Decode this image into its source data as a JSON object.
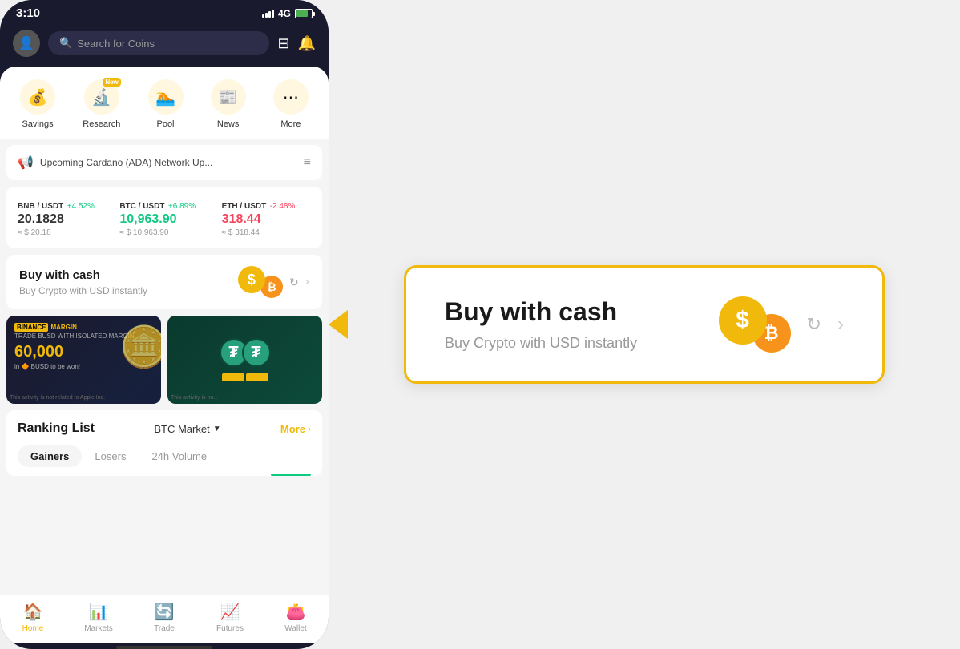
{
  "phone": {
    "statusBar": {
      "time": "3:10",
      "signal": "4G",
      "battery": "80%"
    },
    "searchBar": {
      "placeholder": "Search for Coins"
    },
    "quickActions": [
      {
        "id": "savings",
        "label": "Savings",
        "icon": "💰",
        "badge": null
      },
      {
        "id": "research",
        "label": "Research",
        "icon": "🔬",
        "badge": "New"
      },
      {
        "id": "pool",
        "label": "Pool",
        "icon": "🏊",
        "badge": null
      },
      {
        "id": "news",
        "label": "News",
        "icon": "📰",
        "badge": null
      },
      {
        "id": "more",
        "label": "More",
        "icon": "⋯",
        "badge": null
      }
    ],
    "announcement": {
      "text": "Upcoming Cardano (ADA) Network Up..."
    },
    "priceTicker": [
      {
        "pair": "BNB / USDT",
        "change": "+4.52%",
        "positive": true,
        "price": "20.1828",
        "usd": "≈ $ 20.18"
      },
      {
        "pair": "BTC / USDT",
        "change": "+6.89%",
        "positive": true,
        "price": "10,963.90",
        "usd": "≈ $ 10,963.90"
      },
      {
        "pair": "ETH / USDT",
        "change": "-2.48%",
        "positive": false,
        "price": "318.44",
        "usd": "≈ $ 318.44"
      }
    ],
    "buyCash": {
      "title": "Buy with cash",
      "subtitle": "Buy Crypto with USD instantly"
    },
    "promo": [
      {
        "brand": "BINANCE MARGIN",
        "tag": "TRADE BUSD WITH ISOLATED MARGIN",
        "amount": "60,000",
        "currency": "BUSD",
        "suffix": "to be won!",
        "disclaimer": "This activity is not related to Apple Inc."
      },
      {
        "disclaimer": "This activity is no..."
      }
    ],
    "rankingList": {
      "title": "Ranking List",
      "market": "BTC Market",
      "moreLabel": "More",
      "tabs": [
        {
          "label": "Gainers",
          "active": true
        },
        {
          "label": "Losers",
          "active": false
        },
        {
          "label": "24h Volume",
          "active": false
        }
      ]
    },
    "bottomNav": [
      {
        "id": "home",
        "label": "Home",
        "icon": "🏠",
        "active": true
      },
      {
        "id": "markets",
        "label": "Markets",
        "icon": "📊",
        "active": false
      },
      {
        "id": "trade",
        "label": "Trade",
        "icon": "🔄",
        "active": false
      },
      {
        "id": "futures",
        "label": "Futures",
        "icon": "📈",
        "active": false
      },
      {
        "id": "wallet",
        "label": "Wallet",
        "icon": "👛",
        "active": false
      }
    ]
  },
  "highlightedCard": {
    "title": "Buy with cash",
    "subtitle": "Buy Crypto with USD instantly",
    "chevronLabel": "›"
  }
}
